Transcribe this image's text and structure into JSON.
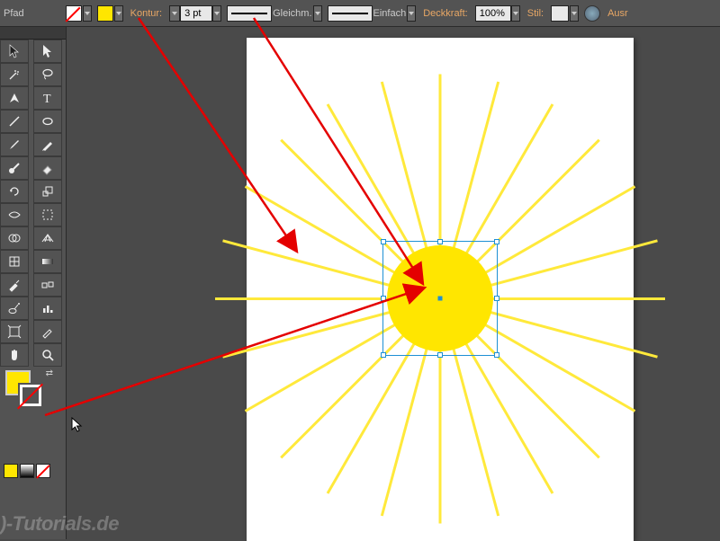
{
  "toolbar": {
    "mode_label": "Pfad",
    "stroke_label": "Kontur:",
    "stroke_weight": "3 pt",
    "cap_text": "Gleichm.",
    "join_text": "Einfach",
    "opacity_label": "Deckkraft:",
    "opacity_value": "100%",
    "style_label": "Stil:",
    "trailing_text": "Ausr",
    "fill_color": "#ffffff",
    "stroke_color": "#ffe600"
  },
  "colors": {
    "fill": "#ffe600",
    "stroke": "none"
  },
  "watermark": ")-Tutorials.de",
  "artwork": {
    "shape": "circle",
    "fill": "#ffe600",
    "rays": 24,
    "selected": true
  }
}
